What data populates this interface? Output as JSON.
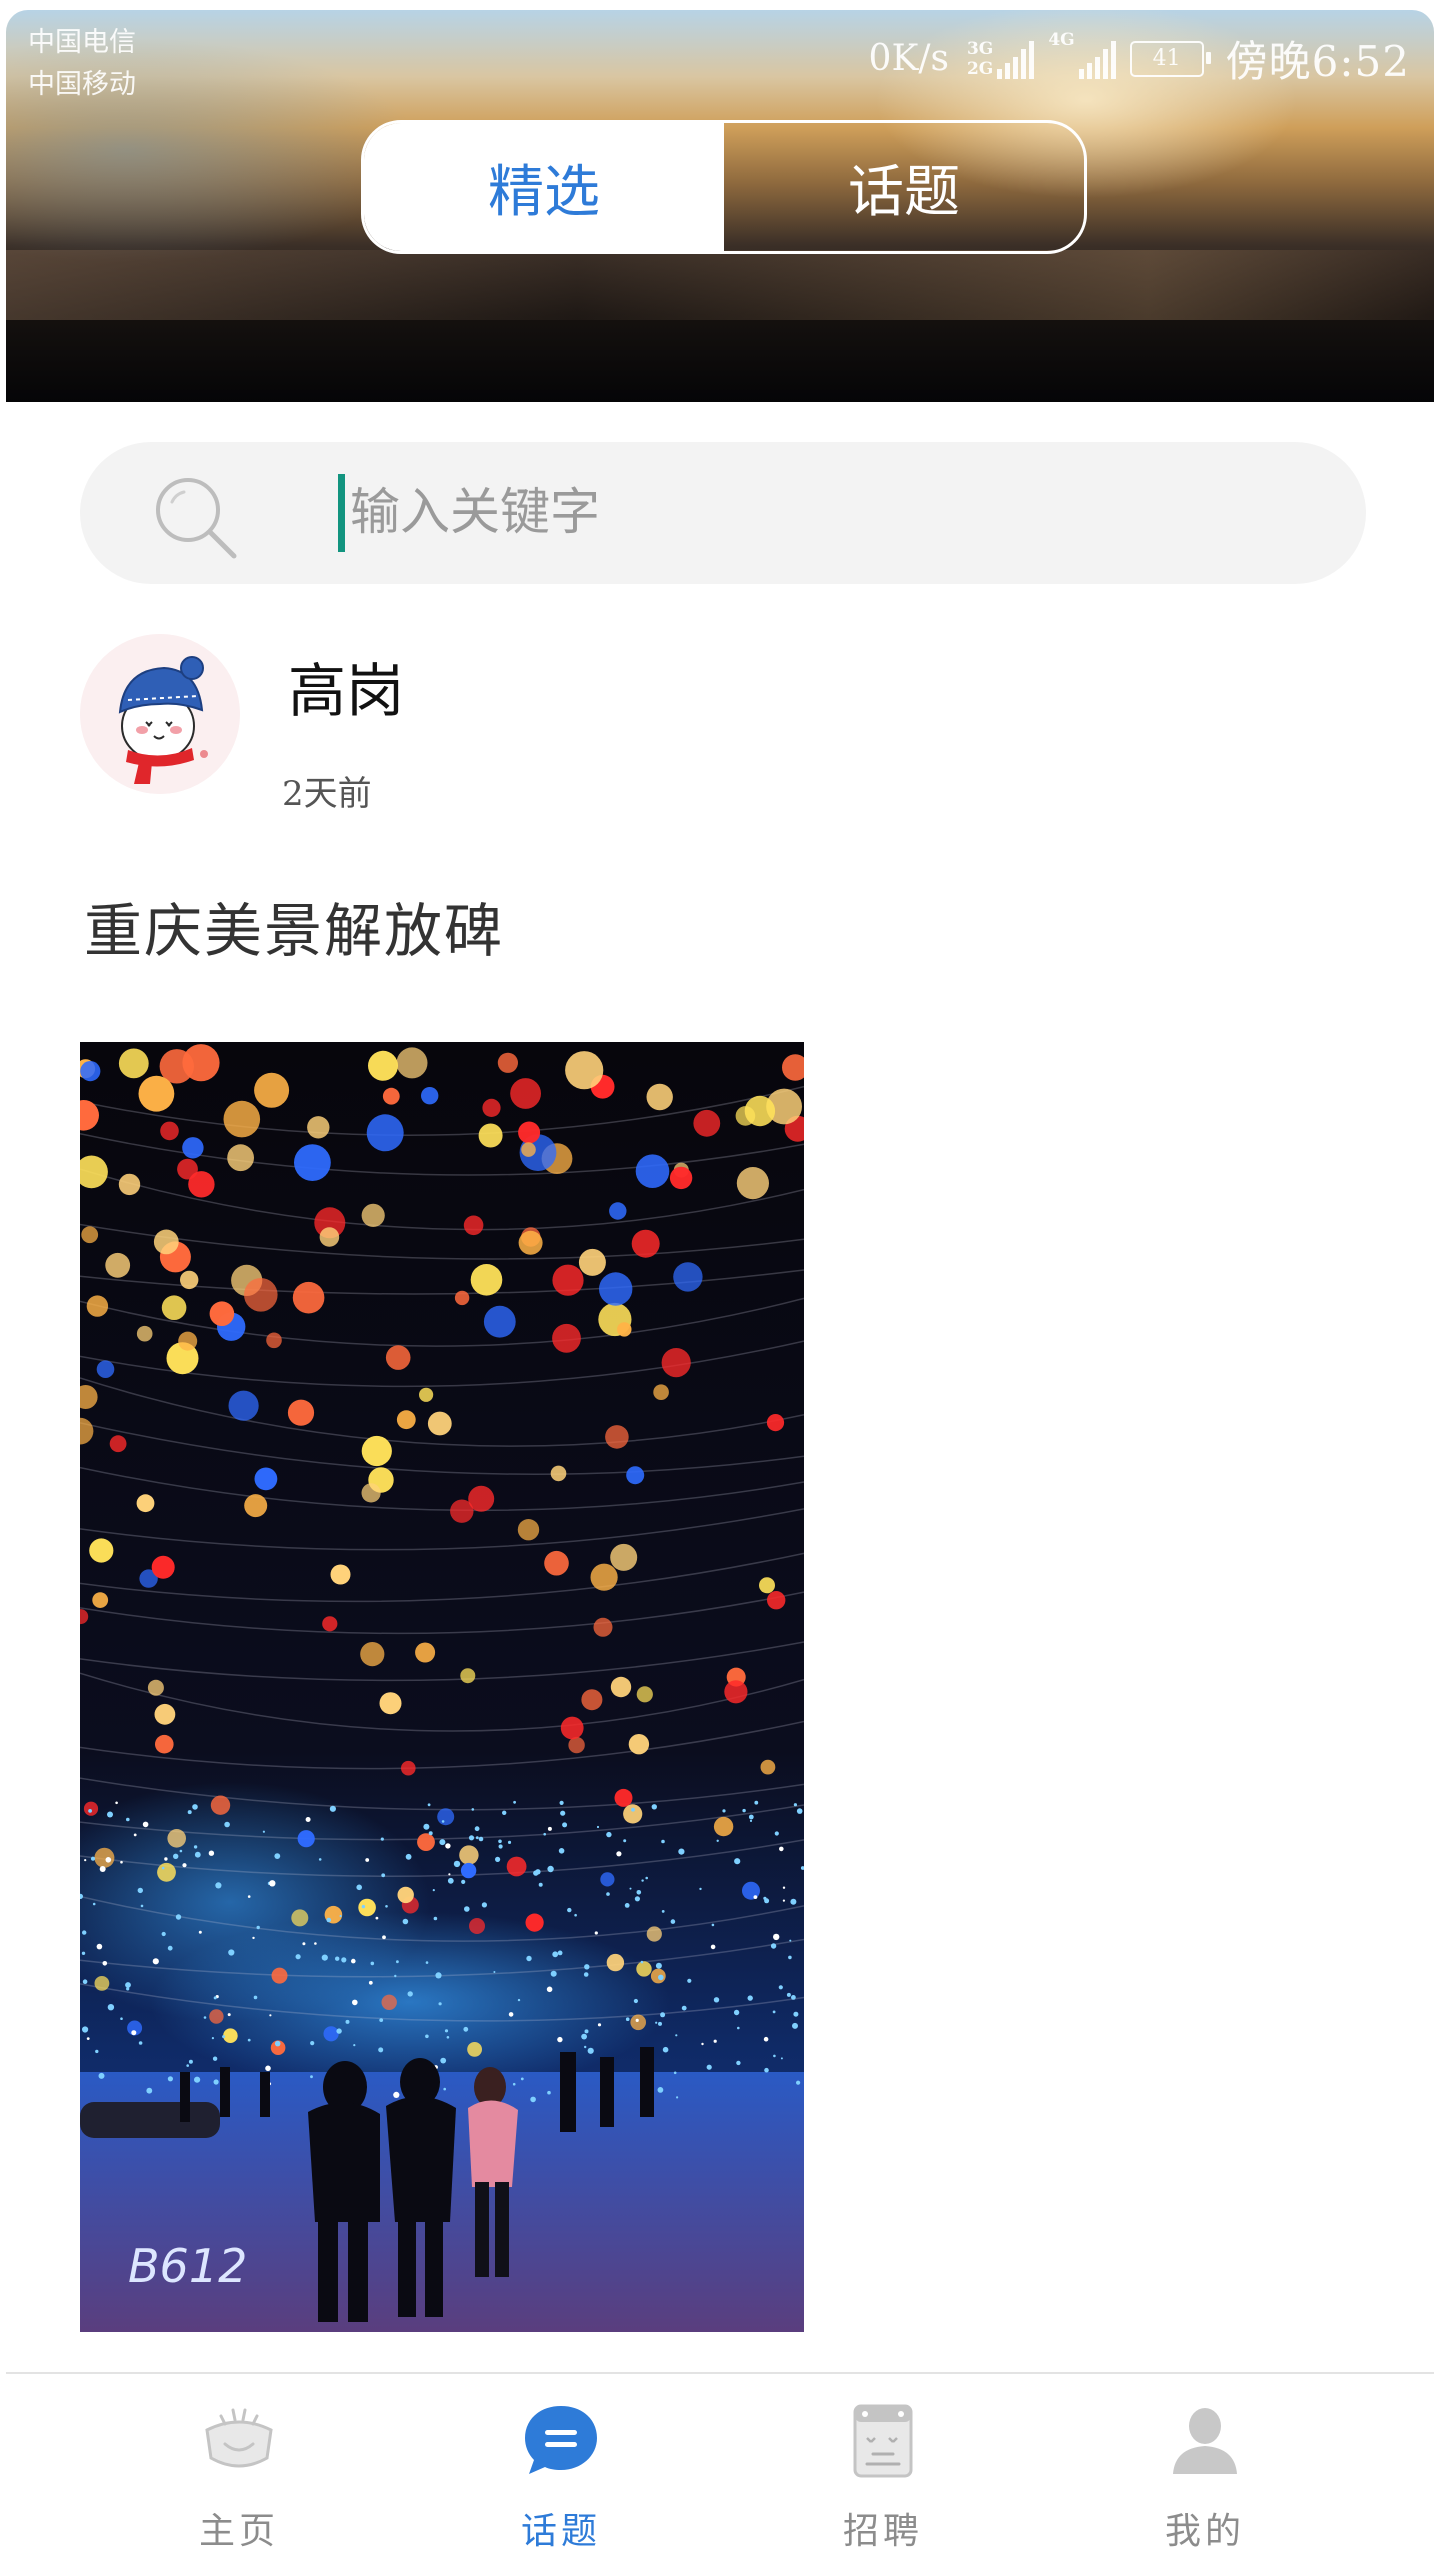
{
  "status_bar": {
    "carrier_1": "中国电信",
    "carrier_2": "中国移动",
    "speed": "0K/s",
    "network_1": "3G",
    "network_2": "2G",
    "network_3": "4G",
    "battery": "41",
    "time": "傍晚6:52"
  },
  "header_tabs": [
    {
      "label": "精选",
      "active": true
    },
    {
      "label": "话题",
      "active": false
    }
  ],
  "search": {
    "placeholder": "输入关键字",
    "value": ""
  },
  "post": {
    "author": "高岗",
    "time": "2天前",
    "title": "重庆美景解放碑",
    "image_watermark": "B612"
  },
  "bottom_nav": [
    {
      "label": "主页",
      "icon": "home-bowl-icon",
      "active": false
    },
    {
      "label": "话题",
      "icon": "chat-bubble-icon",
      "active": true
    },
    {
      "label": "招聘",
      "icon": "job-board-icon",
      "active": false
    },
    {
      "label": "我的",
      "icon": "user-icon",
      "active": false
    }
  ],
  "colors": {
    "accent": "#2e7bd8",
    "caret": "#12947f",
    "nav_inactive": "#8c8c8c"
  }
}
